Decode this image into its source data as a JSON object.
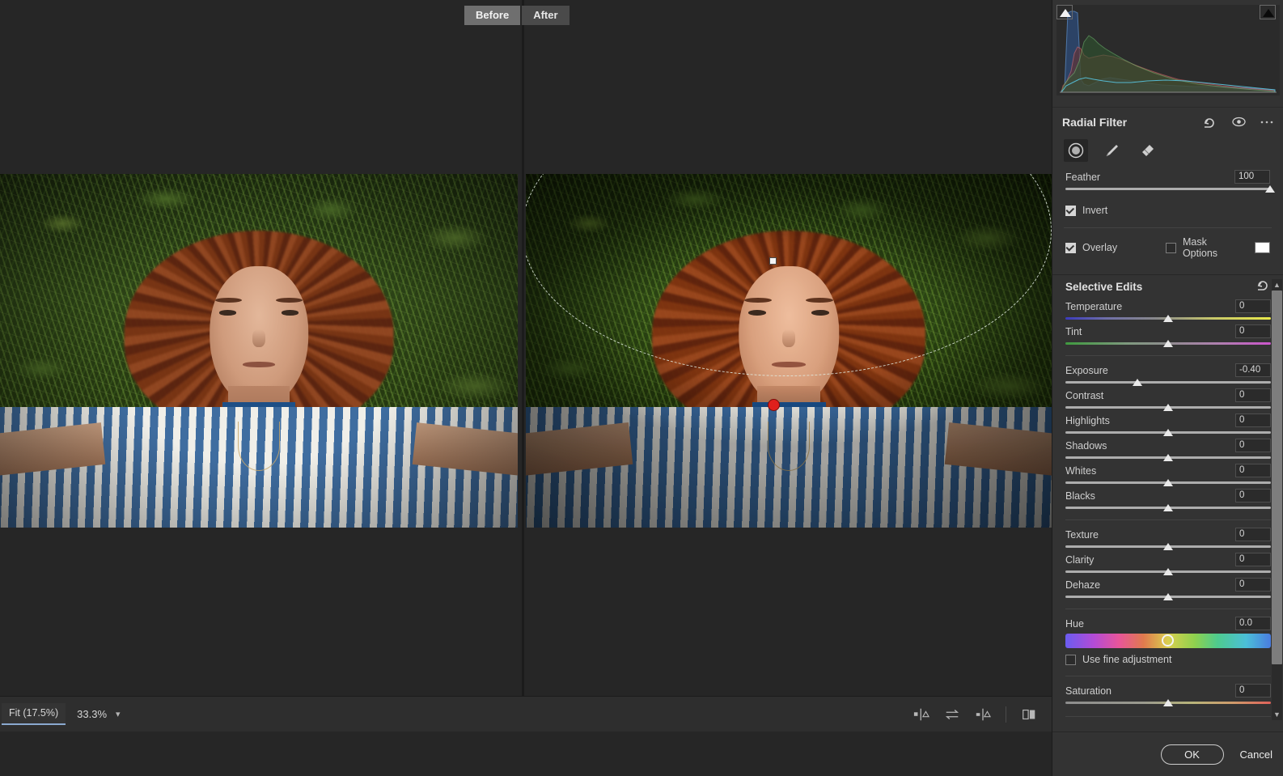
{
  "app": {
    "window_background": "#262626",
    "panel_background": "#333333"
  },
  "compare_tabs": {
    "before_label": "Before",
    "after_label": "After",
    "active": "Before"
  },
  "statusbar": {
    "fit_label": "Fit (17.5%)",
    "zoom_label": "33.3%",
    "zoom_caret_icon": "chevron-down-icon",
    "view_modes": [
      {
        "name": "split-view-vertical-icon"
      },
      {
        "name": "swap-before-after-icon"
      },
      {
        "name": "split-view-center-icon"
      },
      {
        "name": "side-by-side-icon"
      }
    ]
  },
  "histogram": {
    "shadow_clipping_icon": "white-triangle-icon",
    "highlight_clipping_icon": "black-triangle-icon"
  },
  "radial_filter": {
    "title": "Radial Filter",
    "header_icons": [
      {
        "name": "reset-icon",
        "glyph": "↶"
      },
      {
        "name": "eye-visibility-icon",
        "glyph": "◉"
      },
      {
        "name": "more-options-icon",
        "glyph": "⋯"
      }
    ],
    "tools": [
      {
        "name": "radial-tool",
        "label": "Radial",
        "active": true
      },
      {
        "name": "brush-tool",
        "label": "Brush",
        "active": false
      },
      {
        "name": "eraser-tool",
        "label": "Eraser",
        "active": false
      }
    ],
    "feather": {
      "label": "Feather",
      "value": "100",
      "knob_pct": 100
    },
    "invert": {
      "label": "Invert",
      "checked": true
    },
    "overlay": {
      "label": "Overlay",
      "checked": true
    },
    "mask_options": {
      "label": "Mask Options",
      "checked": false,
      "swatch_color": "#ffffff"
    }
  },
  "selective_edits": {
    "title": "Selective Edits",
    "reset_icon": "reset-icon",
    "groups": [
      {
        "name": "white-balance",
        "sliders": [
          {
            "label": "Temperature",
            "value": "0",
            "knob_pct": 50,
            "track": "temp"
          },
          {
            "label": "Tint",
            "value": "0",
            "knob_pct": 50,
            "track": "tint"
          }
        ]
      },
      {
        "name": "tone",
        "sliders": [
          {
            "label": "Exposure",
            "value": "-0.40",
            "knob_pct": 35,
            "track": "plain"
          },
          {
            "label": "Contrast",
            "value": "0",
            "knob_pct": 50,
            "track": "plain"
          },
          {
            "label": "Highlights",
            "value": "0",
            "knob_pct": 50,
            "track": "plain"
          },
          {
            "label": "Shadows",
            "value": "0",
            "knob_pct": 50,
            "track": "plain"
          },
          {
            "label": "Whites",
            "value": "0",
            "knob_pct": 50,
            "track": "plain"
          },
          {
            "label": "Blacks",
            "value": "0",
            "knob_pct": 50,
            "track": "plain"
          }
        ]
      },
      {
        "name": "presence",
        "sliders": [
          {
            "label": "Texture",
            "value": "0",
            "knob_pct": 50,
            "track": "plain"
          },
          {
            "label": "Clarity",
            "value": "0",
            "knob_pct": 50,
            "track": "plain"
          },
          {
            "label": "Dehaze",
            "value": "0",
            "knob_pct": 50,
            "track": "plain"
          }
        ]
      }
    ],
    "hue": {
      "label": "Hue",
      "value": "0.0",
      "knob_pct": 50
    },
    "fine_adjustment": {
      "label": "Use fine adjustment",
      "checked": false
    },
    "saturation": {
      "label": "Saturation",
      "value": "0",
      "knob_pct": 50,
      "track": "sat"
    }
  },
  "footer": {
    "ok_label": "OK",
    "cancel_label": "Cancel"
  },
  "overlay_markers": {
    "pin_color": "#e0201c",
    "ellipse_stroke": "#e1ebe1"
  }
}
